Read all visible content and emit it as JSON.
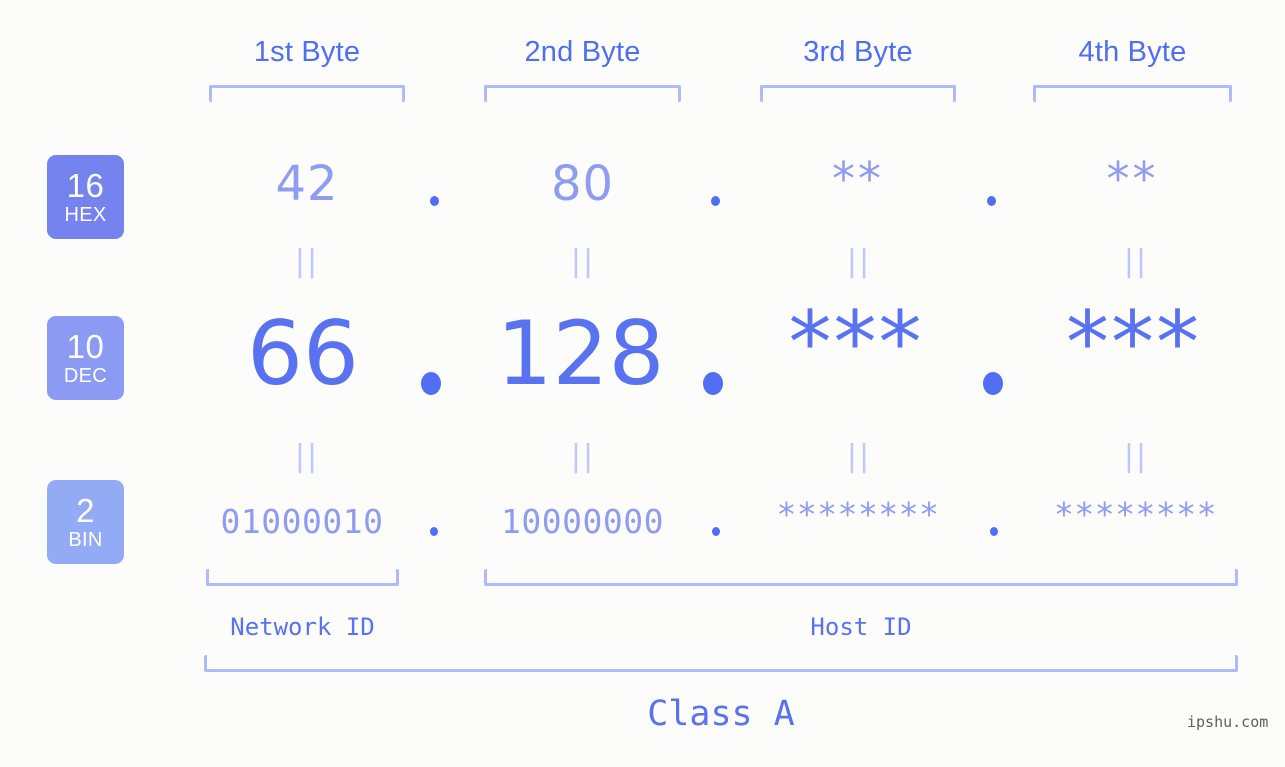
{
  "background_color": "#fcfdfa",
  "accent_color": "#4f6ef2",
  "bracket_color": "#aebbfb",
  "byte_headers": [
    {
      "label": "1st Byte"
    },
    {
      "label": "2nd Byte"
    },
    {
      "label": "3rd Byte"
    },
    {
      "label": "4th Byte"
    }
  ],
  "bases": [
    {
      "number": "16",
      "name": "HEX",
      "color": "#7583ef"
    },
    {
      "number": "10",
      "name": "DEC",
      "color": "#8b9bf4"
    },
    {
      "number": "2",
      "name": "BIN",
      "color": "#93aaf4"
    }
  ],
  "rows": {
    "hex": {
      "base_number": "16",
      "base_name": "HEX",
      "values": [
        "42",
        "80",
        "**",
        "**"
      ]
    },
    "dec": {
      "base_number": "10",
      "base_name": "DEC",
      "values": [
        "66",
        "128",
        "***",
        "***"
      ]
    },
    "bin": {
      "base_number": "2",
      "base_name": "BIN",
      "values": [
        "01000010",
        "10000000",
        "********",
        "********"
      ]
    }
  },
  "separator": ".",
  "equality_mark": "||",
  "regions": [
    {
      "label": "Network ID"
    },
    {
      "label": "Host ID"
    }
  ],
  "class": {
    "label": "Class A"
  },
  "watermark": {
    "text": "ipshu.com"
  }
}
